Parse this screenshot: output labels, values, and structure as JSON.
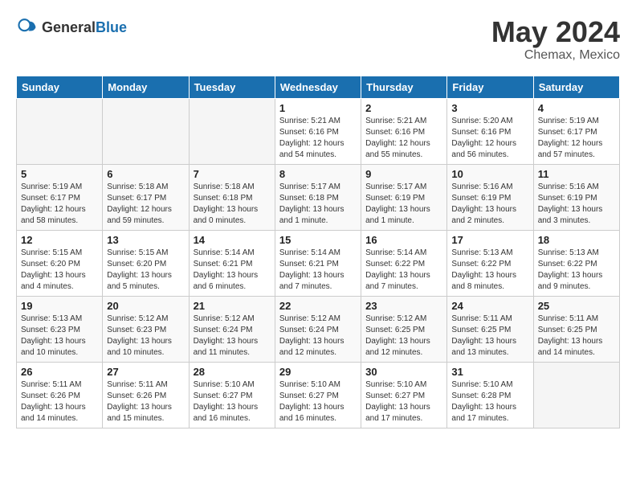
{
  "header": {
    "logo_general": "General",
    "logo_blue": "Blue",
    "month": "May 2024",
    "location": "Chemax, Mexico"
  },
  "weekdays": [
    "Sunday",
    "Monday",
    "Tuesday",
    "Wednesday",
    "Thursday",
    "Friday",
    "Saturday"
  ],
  "weeks": [
    [
      {
        "day": "",
        "info": ""
      },
      {
        "day": "",
        "info": ""
      },
      {
        "day": "",
        "info": ""
      },
      {
        "day": "1",
        "info": "Sunrise: 5:21 AM\nSunset: 6:16 PM\nDaylight: 12 hours\nand 54 minutes."
      },
      {
        "day": "2",
        "info": "Sunrise: 5:21 AM\nSunset: 6:16 PM\nDaylight: 12 hours\nand 55 minutes."
      },
      {
        "day": "3",
        "info": "Sunrise: 5:20 AM\nSunset: 6:16 PM\nDaylight: 12 hours\nand 56 minutes."
      },
      {
        "day": "4",
        "info": "Sunrise: 5:19 AM\nSunset: 6:17 PM\nDaylight: 12 hours\nand 57 minutes."
      }
    ],
    [
      {
        "day": "5",
        "info": "Sunrise: 5:19 AM\nSunset: 6:17 PM\nDaylight: 12 hours\nand 58 minutes."
      },
      {
        "day": "6",
        "info": "Sunrise: 5:18 AM\nSunset: 6:17 PM\nDaylight: 12 hours\nand 59 minutes."
      },
      {
        "day": "7",
        "info": "Sunrise: 5:18 AM\nSunset: 6:18 PM\nDaylight: 13 hours\nand 0 minutes."
      },
      {
        "day": "8",
        "info": "Sunrise: 5:17 AM\nSunset: 6:18 PM\nDaylight: 13 hours\nand 1 minute."
      },
      {
        "day": "9",
        "info": "Sunrise: 5:17 AM\nSunset: 6:19 PM\nDaylight: 13 hours\nand 1 minute."
      },
      {
        "day": "10",
        "info": "Sunrise: 5:16 AM\nSunset: 6:19 PM\nDaylight: 13 hours\nand 2 minutes."
      },
      {
        "day": "11",
        "info": "Sunrise: 5:16 AM\nSunset: 6:19 PM\nDaylight: 13 hours\nand 3 minutes."
      }
    ],
    [
      {
        "day": "12",
        "info": "Sunrise: 5:15 AM\nSunset: 6:20 PM\nDaylight: 13 hours\nand 4 minutes."
      },
      {
        "day": "13",
        "info": "Sunrise: 5:15 AM\nSunset: 6:20 PM\nDaylight: 13 hours\nand 5 minutes."
      },
      {
        "day": "14",
        "info": "Sunrise: 5:14 AM\nSunset: 6:21 PM\nDaylight: 13 hours\nand 6 minutes."
      },
      {
        "day": "15",
        "info": "Sunrise: 5:14 AM\nSunset: 6:21 PM\nDaylight: 13 hours\nand 7 minutes."
      },
      {
        "day": "16",
        "info": "Sunrise: 5:14 AM\nSunset: 6:22 PM\nDaylight: 13 hours\nand 7 minutes."
      },
      {
        "day": "17",
        "info": "Sunrise: 5:13 AM\nSunset: 6:22 PM\nDaylight: 13 hours\nand 8 minutes."
      },
      {
        "day": "18",
        "info": "Sunrise: 5:13 AM\nSunset: 6:22 PM\nDaylight: 13 hours\nand 9 minutes."
      }
    ],
    [
      {
        "day": "19",
        "info": "Sunrise: 5:13 AM\nSunset: 6:23 PM\nDaylight: 13 hours\nand 10 minutes."
      },
      {
        "day": "20",
        "info": "Sunrise: 5:12 AM\nSunset: 6:23 PM\nDaylight: 13 hours\nand 10 minutes."
      },
      {
        "day": "21",
        "info": "Sunrise: 5:12 AM\nSunset: 6:24 PM\nDaylight: 13 hours\nand 11 minutes."
      },
      {
        "day": "22",
        "info": "Sunrise: 5:12 AM\nSunset: 6:24 PM\nDaylight: 13 hours\nand 12 minutes."
      },
      {
        "day": "23",
        "info": "Sunrise: 5:12 AM\nSunset: 6:25 PM\nDaylight: 13 hours\nand 12 minutes."
      },
      {
        "day": "24",
        "info": "Sunrise: 5:11 AM\nSunset: 6:25 PM\nDaylight: 13 hours\nand 13 minutes."
      },
      {
        "day": "25",
        "info": "Sunrise: 5:11 AM\nSunset: 6:25 PM\nDaylight: 13 hours\nand 14 minutes."
      }
    ],
    [
      {
        "day": "26",
        "info": "Sunrise: 5:11 AM\nSunset: 6:26 PM\nDaylight: 13 hours\nand 14 minutes."
      },
      {
        "day": "27",
        "info": "Sunrise: 5:11 AM\nSunset: 6:26 PM\nDaylight: 13 hours\nand 15 minutes."
      },
      {
        "day": "28",
        "info": "Sunrise: 5:10 AM\nSunset: 6:27 PM\nDaylight: 13 hours\nand 16 minutes."
      },
      {
        "day": "29",
        "info": "Sunrise: 5:10 AM\nSunset: 6:27 PM\nDaylight: 13 hours\nand 16 minutes."
      },
      {
        "day": "30",
        "info": "Sunrise: 5:10 AM\nSunset: 6:27 PM\nDaylight: 13 hours\nand 17 minutes."
      },
      {
        "day": "31",
        "info": "Sunrise: 5:10 AM\nSunset: 6:28 PM\nDaylight: 13 hours\nand 17 minutes."
      },
      {
        "day": "",
        "info": ""
      }
    ]
  ]
}
